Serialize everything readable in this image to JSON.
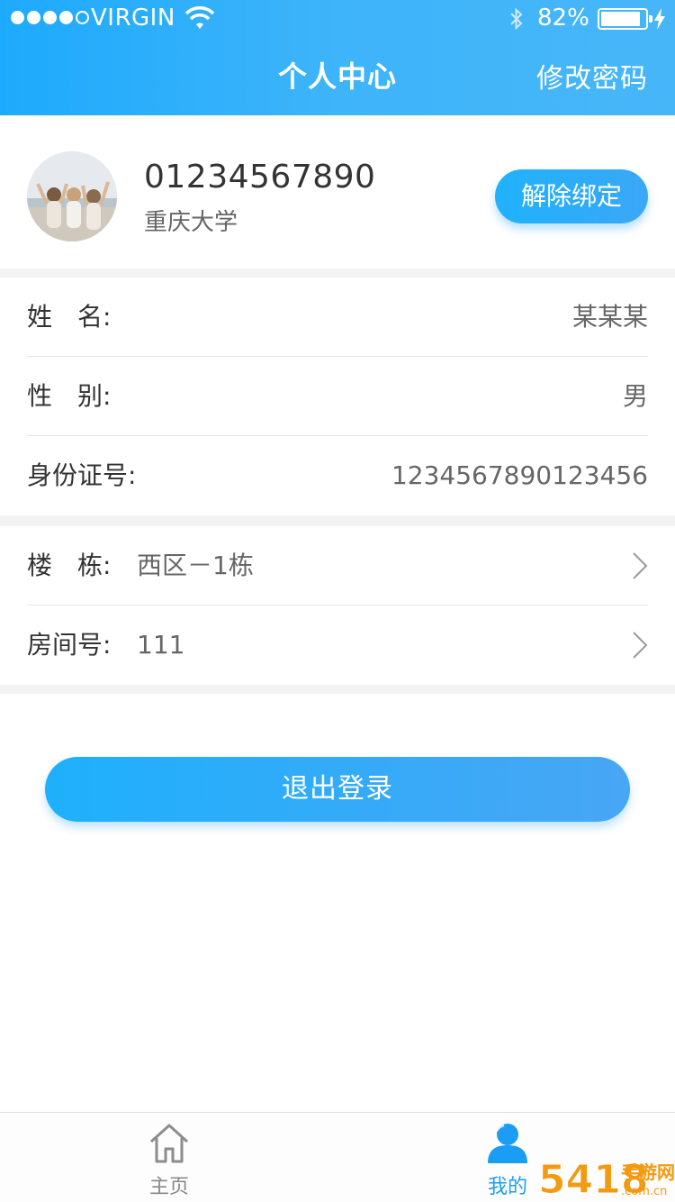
{
  "status_bar": {
    "carrier": "VIRGIN",
    "battery_percent_text": "82%",
    "battery_level": 0.82,
    "signal_bars_filled": 4,
    "signal_bars_total": 5
  },
  "header": {
    "title": "个人中心",
    "right_action": "修改密码",
    "accent_color": "#1eaafc"
  },
  "profile": {
    "phone": "01234567890",
    "school": "重庆大学",
    "unbind_label": "解除绑定"
  },
  "info": {
    "name_label": "姓　名:",
    "name_value": "某某某",
    "gender_label": "性　别:",
    "gender_value": "男",
    "id_label": "身份证号:",
    "id_value": "1234567890123456"
  },
  "dorm": {
    "building_label": "楼　栋:",
    "building_value": "西区－1栋",
    "room_label": "房间号:",
    "room_value": "111"
  },
  "actions": {
    "logout_label": "退出登录"
  },
  "tabbar": {
    "home_label": "主页",
    "home_icon": "home-icon",
    "mine_label": "我的",
    "mine_icon": "user-icon",
    "active_color": "#1c9df5"
  },
  "watermark": {
    "text_main": "5418",
    "text_cn": "手游网",
    "text_domain": ".com.cn"
  }
}
